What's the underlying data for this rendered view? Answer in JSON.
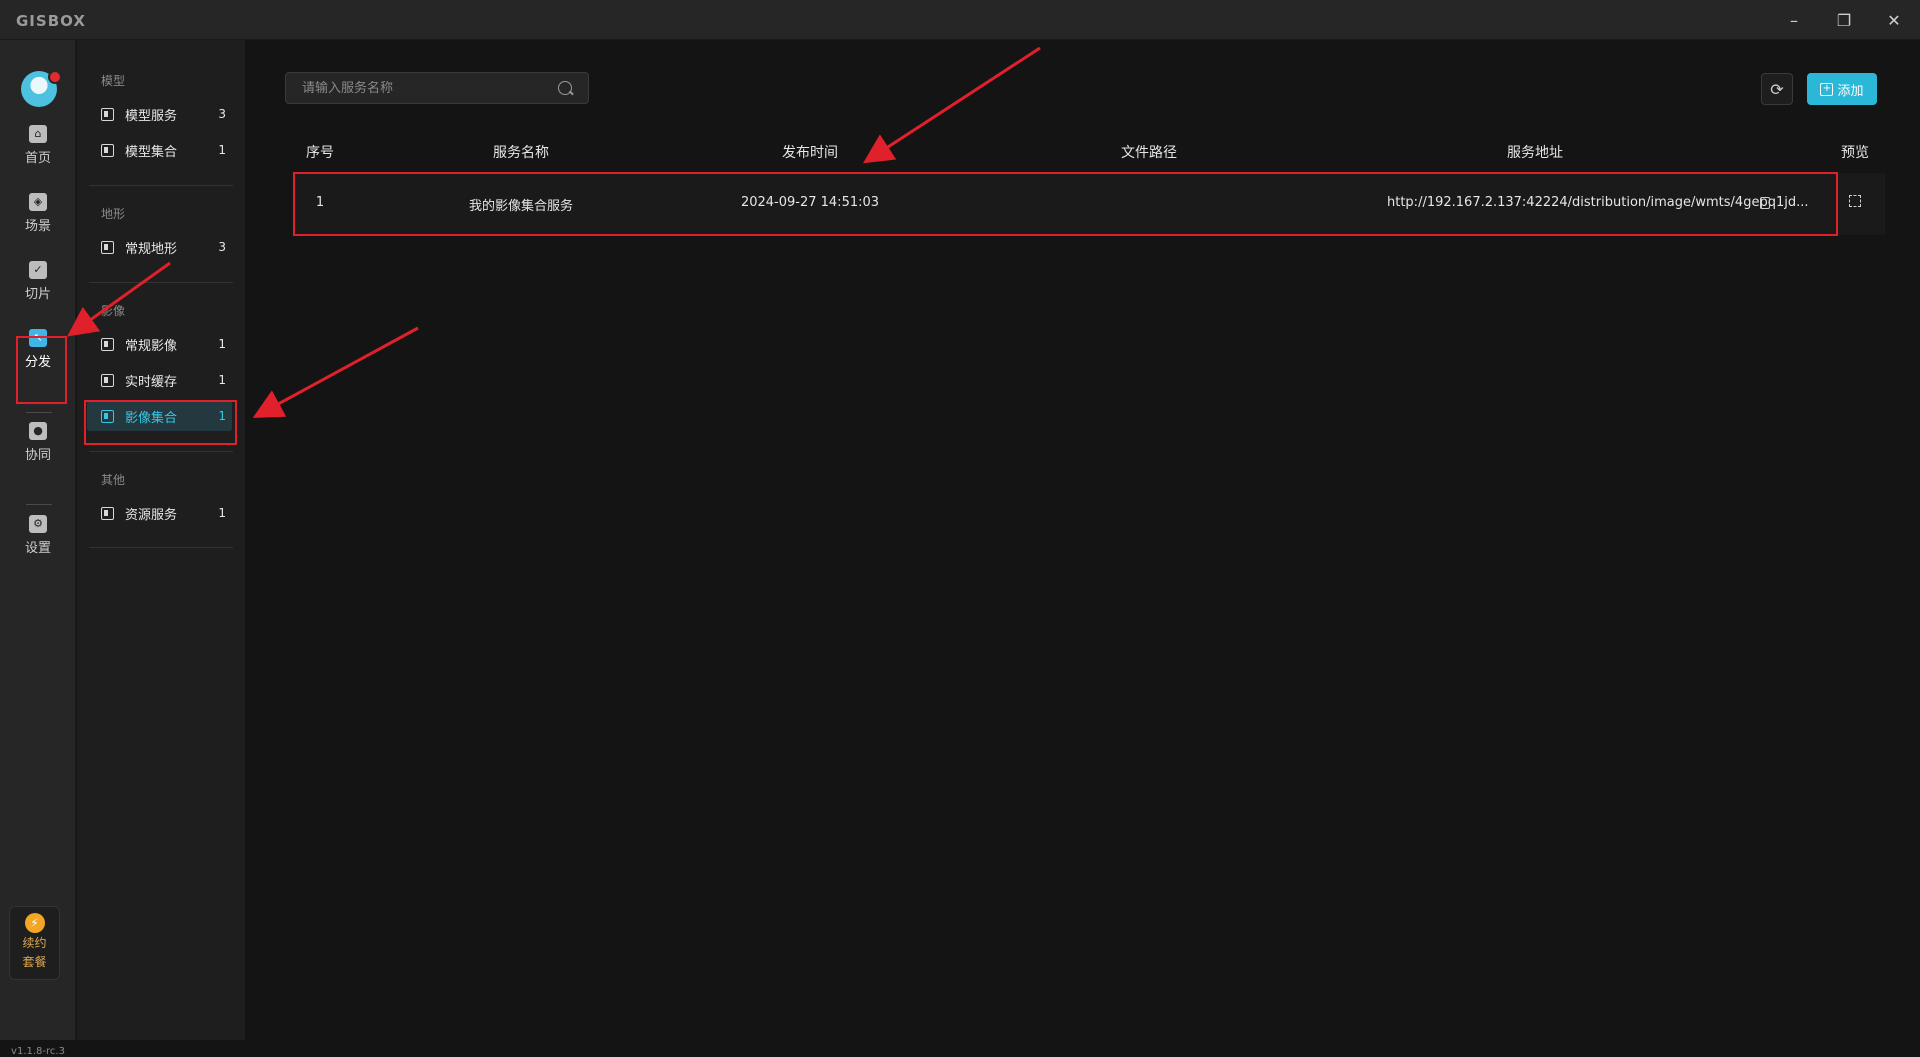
{
  "app": {
    "logo": "GISBOX",
    "version": "v1.1.8-rc.3"
  },
  "window_controls": {
    "minimize": "–",
    "maximize": "❐",
    "close": "✕"
  },
  "rail": {
    "items": [
      {
        "label": "首页",
        "icon": "home-icon"
      },
      {
        "label": "场景",
        "icon": "scene-icon"
      },
      {
        "label": "切片",
        "icon": "slice-icon"
      },
      {
        "label": "分发",
        "icon": "distribute-icon",
        "active": true
      },
      {
        "label": "协同",
        "icon": "collaborate-icon"
      },
      {
        "label": "设置",
        "icon": "settings-icon"
      }
    ],
    "renew": {
      "line1": "续约",
      "line2": "套餐"
    }
  },
  "subnav": {
    "groups": [
      {
        "title": "模型",
        "items": [
          {
            "label": "模型服务",
            "count": "3"
          },
          {
            "label": "模型集合",
            "count": "1"
          }
        ]
      },
      {
        "title": "地形",
        "items": [
          {
            "label": "常规地形",
            "count": "3"
          }
        ]
      },
      {
        "title": "影像",
        "items": [
          {
            "label": "常规影像",
            "count": "1"
          },
          {
            "label": "实时缓存",
            "count": "1"
          },
          {
            "label": "影像集合",
            "count": "1",
            "active": true
          }
        ]
      },
      {
        "title": "其他",
        "items": [
          {
            "label": "资源服务",
            "count": "1"
          }
        ]
      }
    ]
  },
  "search": {
    "placeholder": "请输入服务名称"
  },
  "toolbar": {
    "refresh_icon": "refresh-icon",
    "add_label": "添加"
  },
  "table": {
    "columns": [
      "序号",
      "服务名称",
      "发布时间",
      "文件路径",
      "服务地址",
      "预览"
    ],
    "rows": [
      {
        "index": "1",
        "name": "我的影像集合服务",
        "time": "2024-09-27 14:51:03",
        "path": "",
        "url": "http://192.167.2.137:42224/distribution/image/wmts/4gepq1jd..."
      }
    ]
  },
  "annotation_color": "#e0202a",
  "accent_color": "#2bb7d8"
}
